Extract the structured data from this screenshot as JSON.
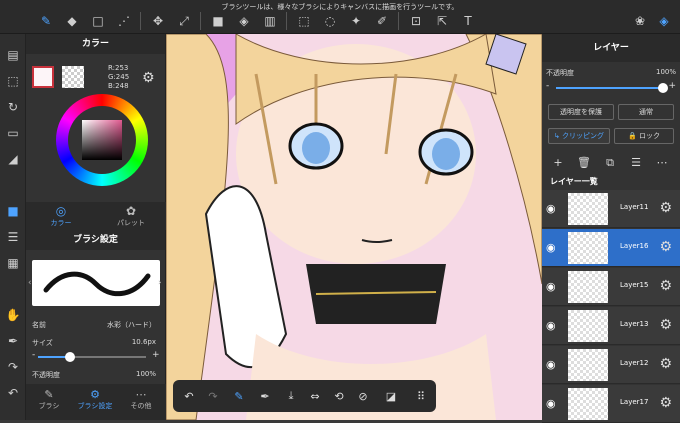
{
  "toolbar": {
    "hint": "ブラシツールは、様々なブラシによりキャンバスに描画を行うツールです。"
  },
  "color_panel": {
    "title": "カラー",
    "r": "R:253",
    "g": "G:245",
    "b": "B:248",
    "tab_color": "カラー",
    "tab_palette": "パレット"
  },
  "brush_panel": {
    "title": "ブラシ設定",
    "name_label": "名前",
    "name_value": "水彩（ハード）",
    "size_label": "サイズ",
    "size_value": "10.6px",
    "size_fraction": 0.3,
    "opacity_label": "不透明度",
    "opacity_value": "100%",
    "tab_brush": "ブラシ",
    "tab_brush_settings": "ブラシ設定",
    "tab_other": "その他"
  },
  "layer_panel": {
    "title": "レイヤー",
    "opacity_label": "不透明度",
    "opacity_value": "100%",
    "protect_label": "透明度を保護",
    "blend_label": "通常",
    "clipping_label": "クリッピング",
    "lock_label": "ロック",
    "list_title": "レイヤー一覧",
    "layers": [
      {
        "name": "Layer11",
        "selected": false
      },
      {
        "name": "Layer16",
        "selected": true
      },
      {
        "name": "Layer15",
        "selected": false
      },
      {
        "name": "Layer13",
        "selected": false
      },
      {
        "name": "Layer12",
        "selected": false
      },
      {
        "name": "Layer17",
        "selected": false
      }
    ]
  },
  "colors": {
    "accent": "#4ea3ff",
    "selected_layer": "#2e6fc9",
    "panel": "#333333",
    "clip_red": "#c8323c"
  }
}
